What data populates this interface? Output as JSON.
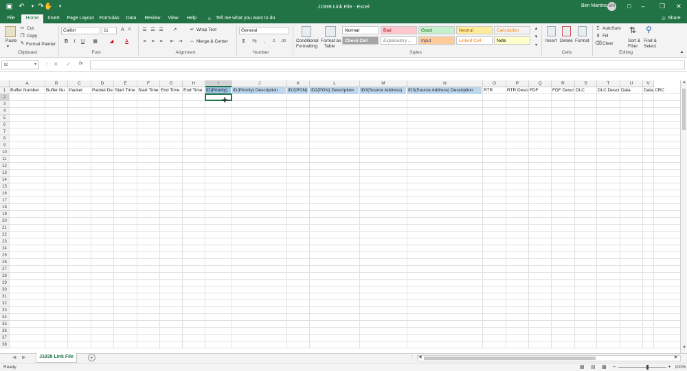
{
  "window": {
    "title": "J1939 Link File  -  Excel",
    "user": "Ben Martins",
    "user_initials": "BM",
    "share_label": "Share"
  },
  "tabs": [
    "File",
    "Home",
    "Insert",
    "Page Layout",
    "Formulas",
    "Data",
    "Review",
    "View",
    "Help"
  ],
  "tell_me": "Tell me what you want to do",
  "ribbon": {
    "clipboard": {
      "paste": "Paste",
      "cut": "Cut",
      "copy": "Copy",
      "format_painter": "Format Painter",
      "label": "Clipboard"
    },
    "font": {
      "name": "Calibri",
      "size": "11",
      "label": "Font"
    },
    "alignment": {
      "wrap": "Wrap Text",
      "merge": "Merge & Center",
      "label": "Alignment"
    },
    "number": {
      "format": "General",
      "label": "Number"
    },
    "styles": {
      "conditional_1": "Conditional",
      "conditional_2": "Formatting",
      "format_table_1": "Format as",
      "format_table_2": "Table",
      "cells": [
        {
          "name": "Normal",
          "bg": "#ffffff",
          "fg": "#000000"
        },
        {
          "name": "Bad",
          "bg": "#ffc7ce",
          "fg": "#9c0006"
        },
        {
          "name": "Good",
          "bg": "#c6efce",
          "fg": "#006100"
        },
        {
          "name": "Neutral",
          "bg": "#ffeb9c",
          "fg": "#9c5700"
        },
        {
          "name": "Calculation",
          "bg": "#f2f2f2",
          "fg": "#fa7d00"
        },
        {
          "name": "Check Cell",
          "bg": "#a5a5a5",
          "fg": "#ffffff"
        },
        {
          "name": "Explanatory ...",
          "bg": "#ffffff",
          "fg": "#7f7f7f"
        },
        {
          "name": "Input",
          "bg": "#ffcc99",
          "fg": "#3f3f76"
        },
        {
          "name": "Linked Cell",
          "bg": "#ffffff",
          "fg": "#fa7d00"
        },
        {
          "name": "Note",
          "bg": "#ffffcc",
          "fg": "#000000"
        }
      ],
      "label": "Styles"
    },
    "cells": {
      "insert": "Insert",
      "delete": "Delete",
      "format": "Format",
      "label": "Cells"
    },
    "editing": {
      "autosum": "AutoSum",
      "fill": "Fill",
      "clear": "Clear",
      "sort_1": "Sort &",
      "sort_2": "Filter",
      "find_1": "Find &",
      "find_2": "Select",
      "label": "Editing"
    }
  },
  "formula_bar": {
    "name_box": "I2",
    "fx": "fx",
    "value": ""
  },
  "columns": [
    "A",
    "B",
    "C",
    "D",
    "E",
    "F",
    "G",
    "H",
    "I",
    "J",
    "K",
    "L",
    "M",
    "N",
    "O",
    "P",
    "Q",
    "R",
    "S",
    "T",
    "U",
    "V"
  ],
  "header_cells": [
    "Buffer Number",
    "Buffer Nu",
    "Packet",
    "Packet De",
    "Start Time",
    "Start Time",
    "End Time",
    "End Time",
    "ID(Priority)",
    "ID(Priority) Description",
    "ID2(PGN)",
    "ID2(PGN) Description",
    "ID3(Source Address)",
    "ID3(Source Address) Description",
    "RTR",
    "RTR Descr",
    "FDF",
    "FDF Descr",
    "DLC",
    "DLC Descr",
    "Data",
    "Data Desc",
    "CRC"
  ],
  "row_numbers": [
    "1",
    "2",
    "3",
    "4",
    "5",
    "6",
    "7",
    "8",
    "9",
    "10",
    "11",
    "12",
    "13",
    "14",
    "15",
    "16",
    "17",
    "18",
    "19",
    "20",
    "21",
    "22",
    "23",
    "24",
    "25",
    "26",
    "27",
    "28",
    "29",
    "30",
    "31",
    "32",
    "33",
    "34",
    "35",
    "36",
    "37",
    "38"
  ],
  "selected_cell": "I2",
  "sheet_tabs": [
    "J1939 Link File"
  ],
  "status": {
    "ready": "Ready",
    "zoom": "100%"
  },
  "colors": {
    "excel_green": "#217346",
    "header_blue": "#9dc3e6",
    "header_blue_light": "#bdd7ee"
  }
}
